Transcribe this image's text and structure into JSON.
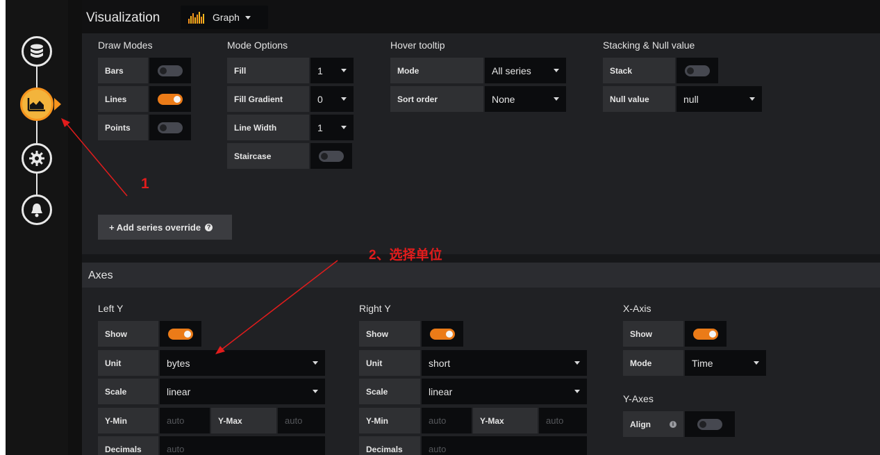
{
  "nav": {
    "items": [
      {
        "name": "queries",
        "icon": "database-icon"
      },
      {
        "name": "visualization",
        "icon": "area-chart-icon",
        "active": true
      },
      {
        "name": "general",
        "icon": "gear-icon"
      },
      {
        "name": "alert",
        "icon": "bell-icon"
      }
    ],
    "active_color": "#f7941d"
  },
  "visualization": {
    "title": "Visualization",
    "picker_label": "Graph",
    "picker_icon": "bar-chart-icon"
  },
  "draw_modes": {
    "title": "Draw Modes",
    "bars": {
      "label": "Bars",
      "enabled": false
    },
    "lines": {
      "label": "Lines",
      "enabled": true
    },
    "points": {
      "label": "Points",
      "enabled": false
    }
  },
  "mode_options": {
    "title": "Mode Options",
    "fill": {
      "label": "Fill",
      "value": "1"
    },
    "fill_gradient": {
      "label": "Fill Gradient",
      "value": "0"
    },
    "line_width": {
      "label": "Line Width",
      "value": "1"
    },
    "staircase": {
      "label": "Staircase",
      "enabled": false
    }
  },
  "hover_tooltip": {
    "title": "Hover tooltip",
    "mode": {
      "label": "Mode",
      "value": "All series"
    },
    "sort_order": {
      "label": "Sort order",
      "value": "None"
    }
  },
  "stacking": {
    "title": "Stacking & Null value",
    "stack": {
      "label": "Stack",
      "enabled": false
    },
    "null_value": {
      "label": "Null value",
      "value": "null"
    }
  },
  "add_override": {
    "label": "+ Add series override",
    "help": "?"
  },
  "axes": {
    "title": "Axes",
    "left_y": {
      "title": "Left Y",
      "show": {
        "label": "Show",
        "enabled": true
      },
      "unit": {
        "label": "Unit",
        "value": "bytes"
      },
      "scale": {
        "label": "Scale",
        "value": "linear"
      },
      "y_min": {
        "label": "Y-Min",
        "placeholder": "auto"
      },
      "y_max": {
        "label": "Y-Max",
        "placeholder": "auto"
      },
      "decimals": {
        "label": "Decimals",
        "placeholder": "auto"
      }
    },
    "right_y": {
      "title": "Right Y",
      "show": {
        "label": "Show",
        "enabled": true
      },
      "unit": {
        "label": "Unit",
        "value": "short"
      },
      "scale": {
        "label": "Scale",
        "value": "linear"
      },
      "y_min": {
        "label": "Y-Min",
        "placeholder": "auto"
      },
      "y_max": {
        "label": "Y-Max",
        "placeholder": "auto"
      },
      "decimals": {
        "label": "Decimals",
        "placeholder": "auto"
      }
    },
    "x_axis": {
      "title": "X-Axis",
      "show": {
        "label": "Show",
        "enabled": true
      },
      "mode": {
        "label": "Mode",
        "value": "Time"
      }
    },
    "y_axes": {
      "title": "Y-Axes",
      "align": {
        "label": "Align",
        "enabled": false,
        "info": "i"
      }
    }
  },
  "annotations": {
    "marker1": "1",
    "marker2": "2、选择单位",
    "color": "#e21c1c"
  }
}
